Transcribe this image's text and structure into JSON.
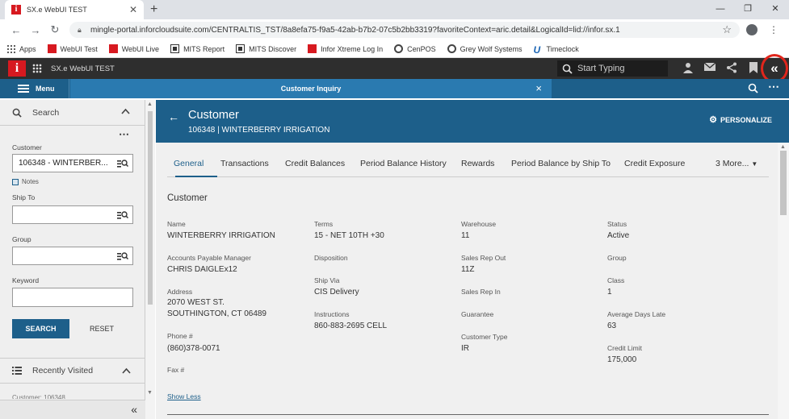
{
  "browser": {
    "tab_title": "SX.e WebUI TEST",
    "tab_favicon": "i",
    "new_tab": "+",
    "url": "mingle-portal.inforcloudsuite.com/CENTRALTIS_TST/8a8efa75-f9a5-42ab-b7b2-07c5b2bb3319?favoriteContext=aric.detail&LogicalId=lid://infor.sx.1",
    "bookmarks": [
      "Apps",
      "WebUI Test",
      "WebUI Live",
      "MITS Report",
      "MITS Discover",
      "Infor Xtreme Log In",
      "CenPOS",
      "Grey Wolf Systems",
      "Timeclock"
    ]
  },
  "app_header": {
    "logo": "i",
    "title": "SX.e WebUI TEST",
    "search_placeholder": "Start Typing",
    "collapse_glyph": "«"
  },
  "bluebar": {
    "menu_label": "Menu",
    "tab_label": "Customer Inquiry",
    "tab_close": "×",
    "more": "⋯"
  },
  "left": {
    "search_label": "Search",
    "more": "⋯",
    "customer_label": "Customer",
    "customer_value": "106348 - WINTERBER...",
    "notes_label": "Notes",
    "shipto_label": "Ship To",
    "group_label": "Group",
    "keyword_label": "Keyword",
    "search_button": "SEARCH",
    "reset_button": "RESET",
    "recent_label": "Recently Visited",
    "recent_peek": "Customer: 106348",
    "collapse_glyph": "«"
  },
  "main": {
    "back": "←",
    "title": "Customer",
    "subtitle": "106348 | WINTERBERRY IRRIGATION",
    "personalize": "PERSONALIZE",
    "tabs": [
      "General",
      "Transactions",
      "Credit Balances",
      "Period Balance History",
      "Rewards",
      "Period Balance by Ship To",
      "Credit Exposure",
      "3 More..."
    ],
    "section_title": "Customer",
    "fields": {
      "name_label": "Name",
      "name_value": "WINTERBERRY IRRIGATION",
      "ap_label": "Accounts Payable Manager",
      "ap_value": "CHRIS DAIGLEx12",
      "address_label": "Address",
      "address_line1": "2070 WEST ST.",
      "address_line2": "SOUTHINGTON, CT 06489",
      "phone_label": "Phone #",
      "phone_value": "(860)378-0071",
      "fax_label": "Fax #",
      "terms_label": "Terms",
      "terms_value": "15 - NET 10TH +30",
      "disposition_label": "Disposition",
      "shipvia_label": "Ship Via",
      "shipvia_value": "CIS Delivery",
      "instructions_label": "Instructions",
      "instructions_value": "860-883-2695 CELL",
      "warehouse_label": "Warehouse",
      "warehouse_value": "11",
      "srout_label": "Sales Rep Out",
      "srout_value": "11Z",
      "srin_label": "Sales Rep In",
      "guarantee_label": "Guarantee",
      "custtype_label": "Customer Type",
      "custtype_value": "IR",
      "status_label": "Status",
      "status_value": "Active",
      "group_label": "Group",
      "class_label": "Class",
      "class_value": "1",
      "adl_label": "Average Days Late",
      "adl_value": "63",
      "cl_label": "Credit Limit",
      "cl_value": "175,000"
    },
    "show_less": "Show Less"
  },
  "colors": {
    "brand_red": "#d71920",
    "primary_blue": "#1d5f8a",
    "highlight_red": "#e1261c"
  }
}
